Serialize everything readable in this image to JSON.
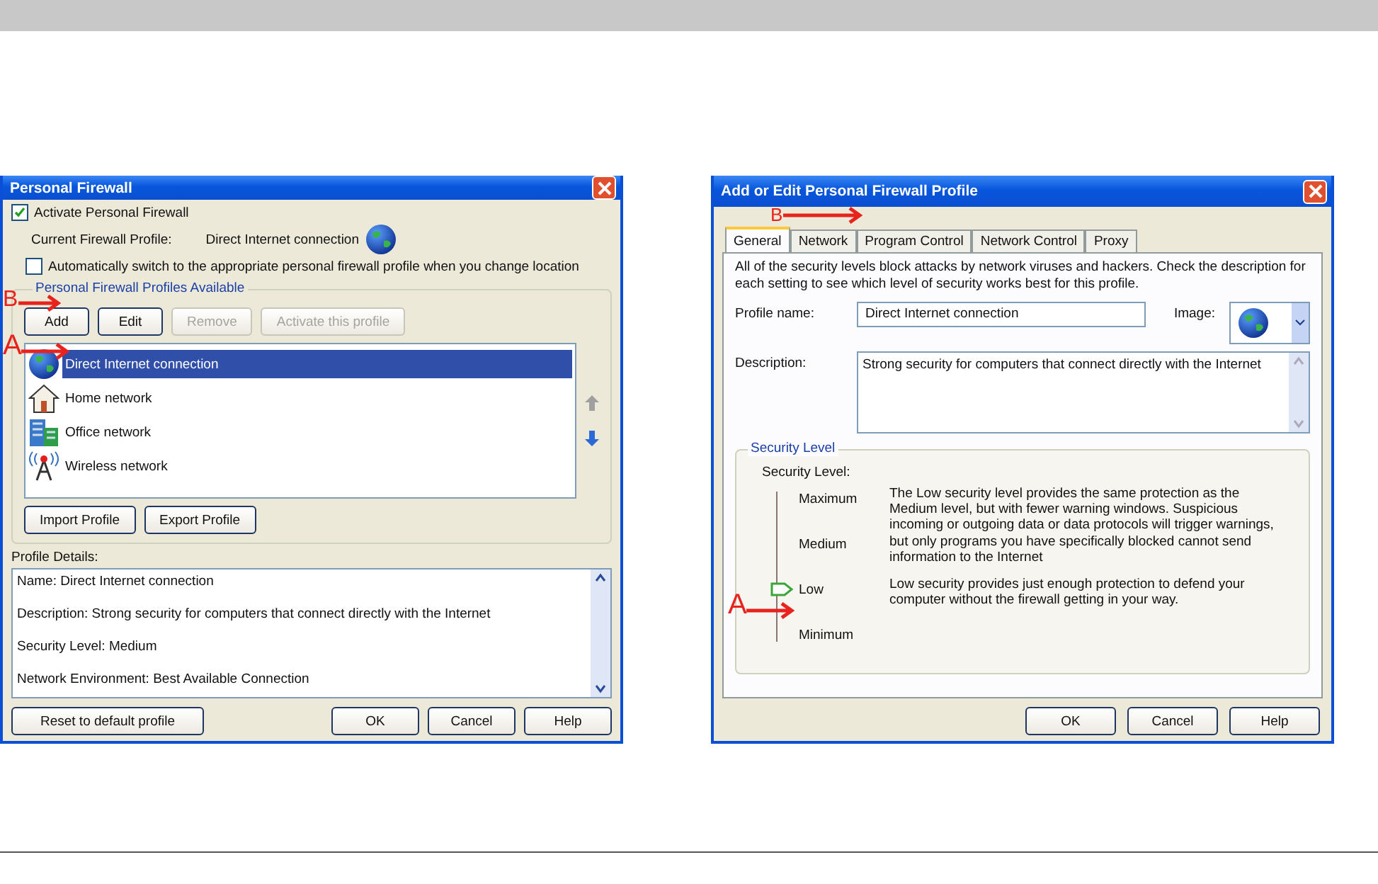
{
  "left_window": {
    "title": "Personal Firewall",
    "activate": {
      "label": "Activate Personal Firewall",
      "checked": true
    },
    "current_profile": {
      "label": "Current Firewall Profile:",
      "value": "Direct Internet connection"
    },
    "auto_switch": {
      "label": "Automatically switch to the appropriate personal firewall profile when you change location",
      "checked": false
    },
    "profiles_group": {
      "title": "Personal Firewall Profiles Available",
      "buttons": [
        {
          "label": "Add",
          "disabled": false
        },
        {
          "label": "Edit",
          "disabled": false
        },
        {
          "label": "Remove",
          "disabled": true
        },
        {
          "label": "Activate this profile",
          "disabled": true
        }
      ],
      "items": [
        {
          "label": "Direct Internet connection",
          "kind": "globe",
          "selected": true
        },
        {
          "label": "Home network",
          "kind": "house",
          "selected": false
        },
        {
          "label": "Office network",
          "kind": "building",
          "selected": false
        },
        {
          "label": "Wireless network",
          "kind": "tower",
          "selected": false
        }
      ],
      "bottom_buttons": [
        "Import Profile",
        "Export Profile"
      ]
    },
    "details": {
      "label": "Profile Details:",
      "lines": [
        "Name: Direct Internet connection",
        "Description: Strong security for computers that connect directly with the Internet",
        "Security Level: Medium",
        "Network Environment: Best Available Connection"
      ]
    },
    "buttons": [
      "Reset to default profile",
      "OK",
      "Cancel",
      "Help"
    ],
    "annotations": [
      {
        "label": "B"
      },
      {
        "label": "A"
      }
    ]
  },
  "right_window": {
    "title": "Add or Edit Personal Firewall Profile",
    "tabs": [
      {
        "label": "General",
        "selected": true
      },
      {
        "label": "Network",
        "selected": false
      },
      {
        "label": "Program Control",
        "selected": false
      },
      {
        "label": "Network Control",
        "selected": false
      },
      {
        "label": "Proxy",
        "selected": false
      }
    ],
    "intro": "All of the security levels block attacks by network viruses and hackers. Check the description for each setting to see which level of security works best for this profile.",
    "profile_name": {
      "label": "Profile name:",
      "value": "Direct Internet connection"
    },
    "image": {
      "label": "Image:"
    },
    "description": {
      "label": "Description:",
      "value": "Strong security for computers that connect directly with the Internet"
    },
    "security_group": {
      "title": "Security Level",
      "label": "Security Level:",
      "level": 0.333,
      "levels": [
        "Maximum",
        "Medium",
        "Low",
        "Minimum"
      ],
      "texts": [
        "The Low security level provides the same protection as the Medium level, but with fewer warning windows. Suspicious incoming or outgoing data or data protocols will trigger warnings, but only programs you have specifically blocked cannot send information to the Internet",
        "Low security provides just enough protection to defend your computer without the firewall getting in your way."
      ]
    },
    "buttons": [
      "OK",
      "Cancel",
      "Help"
    ],
    "annotations": [
      {
        "label": "B"
      },
      {
        "label": "A"
      }
    ]
  }
}
